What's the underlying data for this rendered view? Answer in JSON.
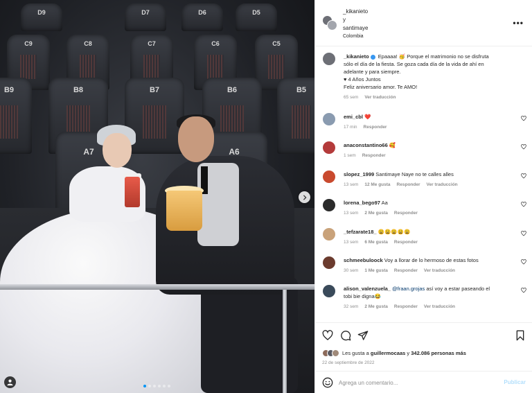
{
  "post": {
    "carousel": {
      "total_slides": 6,
      "active_slide": 1
    },
    "icons": {
      "next": "chevron-right-icon",
      "tagged_users": "user-icon"
    }
  },
  "header": {
    "user1": "_kikanieto",
    "connector": "y",
    "user2": "santimaye",
    "location": "Colombia",
    "more_icon": "more-horizontal-icon"
  },
  "caption": {
    "user": "_kikanieto",
    "line1": "Epaaaa! 🥳 Porque el matrimonio no se disfruta",
    "line2": "sólo el día de la fiesta. Se goza cada día de la vida de ahí en",
    "line3": "adelante y para siempre.",
    "line4": "♥ 4 Años Juntos",
    "line5": "Feliz aniversario amor. Te AMO!",
    "time": "65 sem",
    "translate": "Ver traducción"
  },
  "comments": [
    {
      "user": "emi_cbl",
      "text": "❤️",
      "time": "17 min",
      "likes": "",
      "reply": "Responder",
      "translate": "",
      "avatar_color": "#8a9bb0"
    },
    {
      "user": "anaconstantino66",
      "text": "🥰",
      "time": "1 sem",
      "likes": "",
      "reply": "Responder",
      "translate": "",
      "avatar_color": "#b43b3b"
    },
    {
      "user": "slopez_1999",
      "text": "Santimaye Naye no te calles alles",
      "time": "13 sem",
      "likes": "12 Me gusta",
      "reply": "Responder",
      "translate": "Ver traducción",
      "avatar_color": "#c94a2e"
    },
    {
      "user": "lorena_bego97",
      "text": "Aa",
      "time": "13 sem",
      "likes": "2 Me gusta",
      "reply": "Responder",
      "translate": "",
      "avatar_color": "#2b2b2b"
    },
    {
      "user": "_tefzarate18_",
      "text": "😩😩😩😩😩",
      "time": "13 sem",
      "likes": "6 Me gusta",
      "reply": "Responder",
      "translate": "",
      "avatar_color": "#c9a27a"
    },
    {
      "user": "schmeebuloock",
      "text": "Voy a llorar de lo hermoso de estas fotos",
      "time": "30 sem",
      "likes": "1 Me gusta",
      "reply": "Responder",
      "translate": "Ver traducción",
      "avatar_color": "#6b3b2e"
    },
    {
      "user": "alison_valenzuela_",
      "mention": "@fraan.grojas",
      "text": "así voy a estar paseando el",
      "text2": "tobi bie digna😂",
      "time": "32 sem",
      "likes": "2 Me gusta",
      "reply": "Responder",
      "translate": "Ver traducción",
      "avatar_color": "#3a4a5a"
    }
  ],
  "actions": {
    "like_icon": "heart-icon",
    "comment_icon": "comment-icon",
    "share_icon": "send-icon",
    "save_icon": "bookmark-icon",
    "likes_prefix": "Les gusta a",
    "likes_user": "guillermocaas",
    "likes_connector": "y",
    "likes_count": "342.086 personas más",
    "date": "22 de septiembre de 2022"
  },
  "composer": {
    "emoji_icon": "emoji-icon",
    "placeholder": "Agrega un comentario...",
    "publish": "Publicar"
  }
}
